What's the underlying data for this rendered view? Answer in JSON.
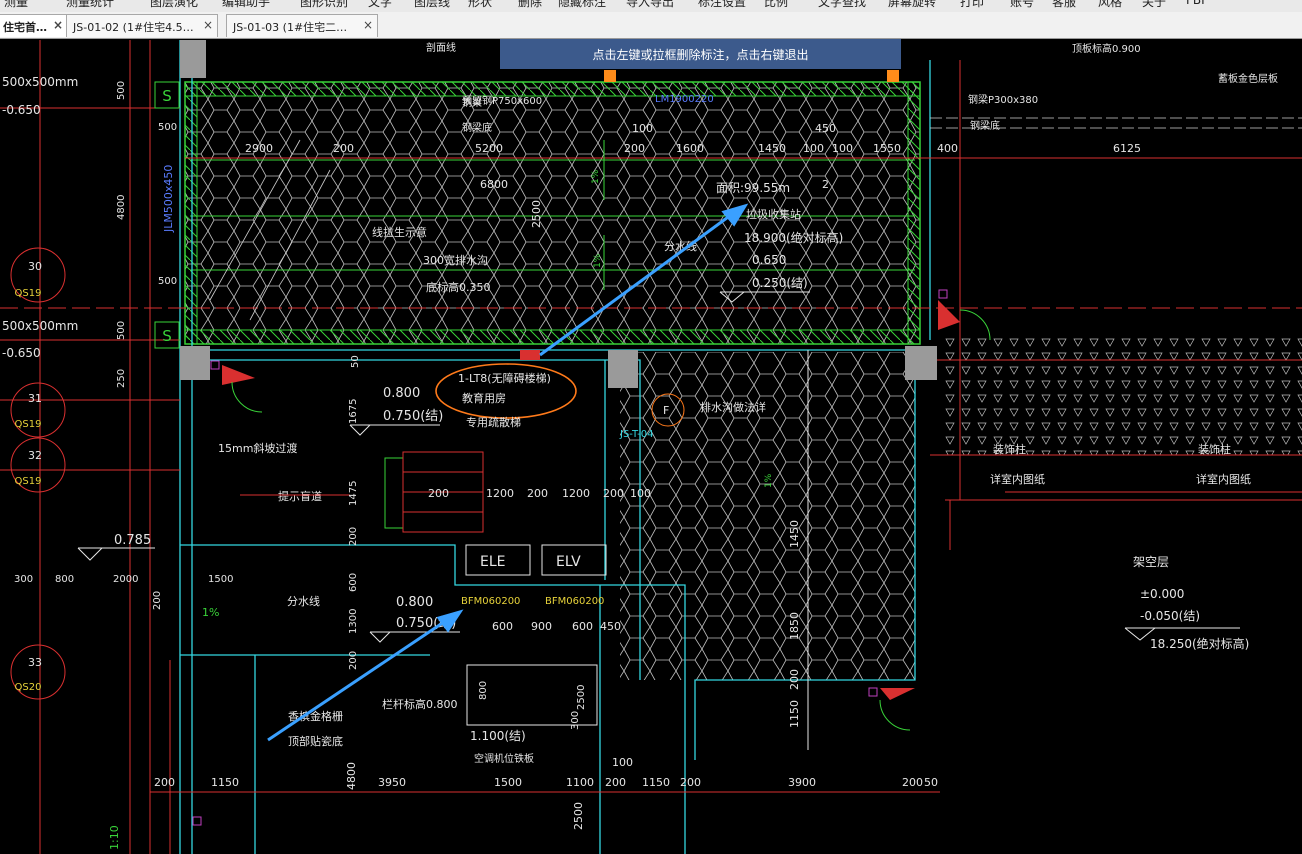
{
  "menu": {
    "items": [
      "测量",
      "测量统计",
      "图层演化",
      "编辑助手",
      "图形识别",
      "文字",
      "图层线",
      "形状",
      "删除",
      "隐藏标注",
      "导入导出",
      "标注设置",
      "比例",
      "文字查找",
      "屏幕旋转",
      "打印",
      "账号",
      "客服",
      "风格",
      "关于",
      "FBI"
    ]
  },
  "tabs": [
    {
      "label": "住宅首…",
      "active": true
    },
    {
      "label": "JS-01-02 (1#住宅4.5…",
      "active": false
    },
    {
      "label": "JS-01-03 (1#住宅二…",
      "active": false
    }
  ],
  "tab_close_glyph": "×",
  "banner": {
    "text": "点击左键或拉框删除标注，点击右键退出"
  },
  "drawing": {
    "top_dims": [
      "2900",
      "200",
      "5200",
      "100",
      "200",
      "1600",
      "1450",
      "100",
      "100",
      "1550",
      "400",
      "6125"
    ],
    "inner_dims": [
      "6800",
      "2500",
      "450",
      "2"
    ],
    "left_texts": [
      "500x500mm",
      "-0.650",
      "500x500mm",
      "-0.650"
    ],
    "left_dims": [
      "500",
      "500",
      "4800",
      "500",
      "500",
      "250",
      "200",
      "300",
      "800",
      "2000",
      "1500"
    ],
    "grid_labels": [
      {
        "num": "30",
        "sub": "QS19"
      },
      {
        "num": "31",
        "sub": "QS19"
      },
      {
        "num": "32",
        "sub": "QS19"
      },
      {
        "num": "33",
        "sub": "QS20"
      }
    ],
    "s_markers": [
      "S",
      "S"
    ],
    "beam_label": "JLM500x450",
    "lm_label": "LM1900220",
    "top_notes": [
      "钢梁",
      "预留钢P750x600",
      "钢梁底",
      "钢梁P300x380",
      "钢梁底",
      "剖面线",
      "顶板标高0.900",
      "蓄板金色层板"
    ],
    "area_text": "面积:99.55m",
    "collect_well": "垃圾收集站",
    "elevations_right": [
      "18.900(绝对标高)",
      "0.650",
      "0.250(结)"
    ],
    "mid_notes": [
      "线拉生示意",
      "300宽排水沟",
      "底标高0.350",
      "分水线"
    ],
    "circled_notes": [
      "1-LT8(无障碍楼梯)",
      "教育用房",
      "专用疏散梯"
    ],
    "floor_elev_1": [
      "0.800",
      "0.750(结)"
    ],
    "floor_elev_2": [
      "0.800",
      "0.750(结)"
    ],
    "slope_note": "15mm斜坡过渡",
    "guide_note": "提示盲道",
    "stair_dims": [
      "200",
      "1200",
      "200",
      "1200",
      "200",
      "100"
    ],
    "elevators": [
      "ELE",
      "ELV"
    ],
    "door_labels": [
      "BFM060200",
      "BFM060200"
    ],
    "lower_dims": [
      "600",
      "900",
      "600",
      "450"
    ],
    "elev_785": "0.785",
    "fen_shui": "分水线",
    "percent": "1%",
    "slope_marks": [
      "1%",
      "1%",
      "1%"
    ],
    "roof_note": [
      "香槟金格栅",
      "顶部贴瓷底"
    ],
    "sill_note": "栏杆标高0.800",
    "ac_note": [
      "1.100(结)",
      "空调机位铁板"
    ],
    "ac_dims": [
      "800",
      "2500",
      "300"
    ],
    "drain_note": "排水沟做法详",
    "drain_ref": "JS-T-04",
    "ref_circle": "F",
    "right_notes": [
      "装饰柱",
      "详室内图纸",
      "装饰柱",
      "详室内图纸"
    ],
    "jiakong": [
      "架空层",
      "±0.000",
      "-0.050(结)",
      "18.250(绝对标高)"
    ],
    "vert_dims": [
      "1450",
      "1850",
      "200",
      "1150"
    ],
    "bottom_dims": [
      "200",
      "1150",
      "3950",
      "1500",
      "1100",
      "200",
      "100",
      "1150",
      "200",
      "3900",
      "200",
      "50"
    ],
    "bottom_left": [
      "4800",
      "2500",
      "1:10"
    ],
    "side_dims": [
      "1675",
      "1475",
      "200",
      "600",
      "1300",
      "200",
      "50"
    ]
  }
}
